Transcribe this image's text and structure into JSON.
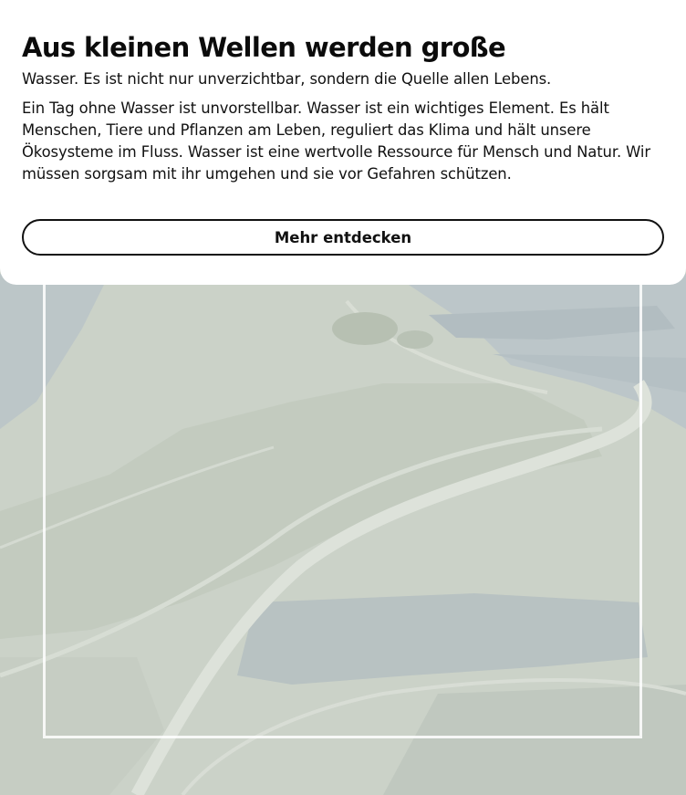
{
  "teaser": {
    "title": "Aus kleinen Wellen werden große",
    "lead": "Wasser. Es ist nicht nur unverzichtbar, sondern die Quelle allen Lebens.",
    "body": "Ein Tag ohne Wasser ist unvorstellbar. Wasser ist ein wichtiges Element. Es hält Menschen, Tiere und Pflanzen am Leben, reguliert das Klima und hält unsere Ökosysteme im Fluss. Wasser ist eine wertvolle Ressource für Mensch und Natur. Wir müssen sorgsam mit ihr umgehen und sie vor Gefahren schützen.",
    "cta_label": "Mehr entdecken"
  },
  "colors": {
    "card_background": "#ffffff",
    "text": "#111111",
    "background_land": "#c9d0c6",
    "background_water": "#b9c3c6"
  }
}
